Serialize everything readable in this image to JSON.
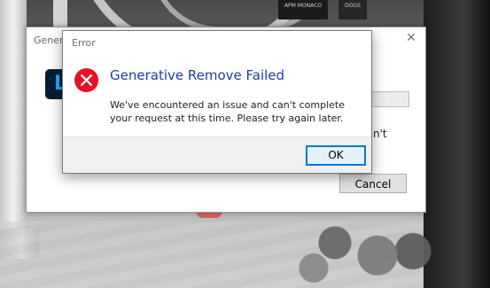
{
  "background": {
    "sign_left": "APM MONACO",
    "sign_right": "DOGS"
  },
  "back_dialog": {
    "title": "Genera",
    "close_glyph": "✕",
    "logo_letter": "L",
    "text_fragment": "n't",
    "cancel_label": "Cancel"
  },
  "error_dialog": {
    "title": "Error",
    "heading": "Generative Remove Failed",
    "message": "We've encountered an issue and can't complete your request at this time. Please try again later.",
    "ok_label": "OK",
    "icon": "error-icon",
    "colors": {
      "heading": "#1e3f9a",
      "icon_fill": "#e81123",
      "ok_border": "#0078d7"
    }
  }
}
